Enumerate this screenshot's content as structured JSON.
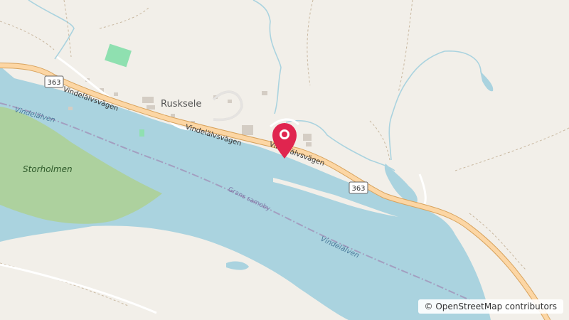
{
  "map": {
    "place": "Rusksele",
    "island": "Storholmen",
    "road_name": "Vindelälvsvägen",
    "road_number": "363",
    "river": "Vindelälven",
    "boundary_label": "Grans sameby",
    "colors": {
      "land": "#f2efe9",
      "water": "#aad3df",
      "forest": "#add19e",
      "park": "#8fe0b0",
      "road_primary": "#fcd6a4",
      "road_casing": "#d8a35d",
      "building": "#d4cdc4",
      "marker": "#e0254f"
    }
  },
  "marker": {
    "icon": "map-pin-icon"
  },
  "attribution": {
    "text": "© OpenStreetMap contributors"
  }
}
